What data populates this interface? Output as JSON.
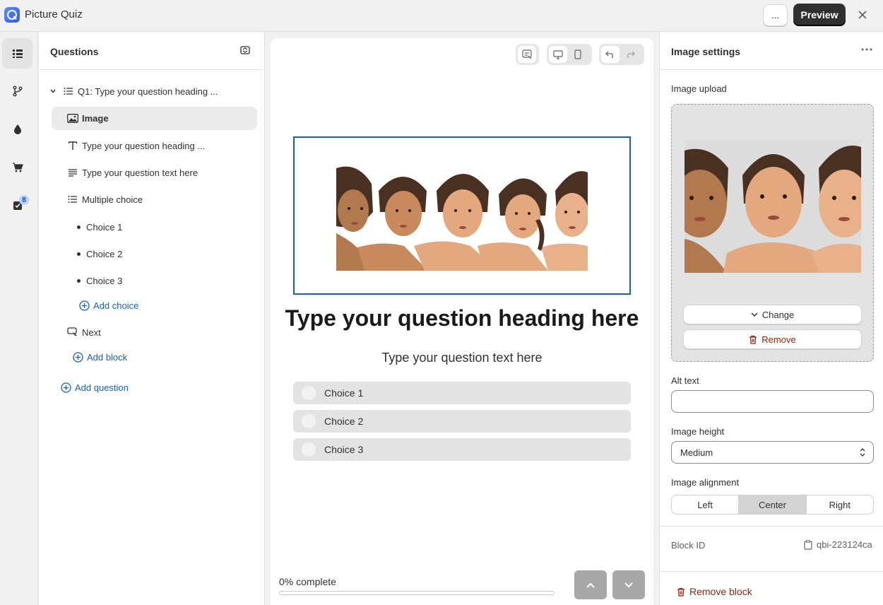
{
  "app": {
    "title": "Picture Quiz"
  },
  "topbar": {
    "more_label": "...",
    "preview_label": "Preview"
  },
  "rail": {
    "badge_count": "8"
  },
  "questions_panel": {
    "title": "Questions",
    "question": "Q1: Type your question heading ...",
    "blocks": {
      "image": "Image",
      "heading": "Type your question heading ...",
      "text": "Type your question text here",
      "multiple_choice": "Multiple choice",
      "choices": [
        "Choice 1",
        "Choice 2",
        "Choice 3"
      ],
      "add_choice": "Add choice",
      "next": "Next",
      "add_block": "Add block"
    },
    "add_question": "Add question"
  },
  "preview": {
    "heading": "Type your question heading here",
    "text": "Type your question text here",
    "choices": [
      "Choice 1",
      "Choice 2",
      "Choice 3"
    ],
    "progress_label": "0% complete",
    "progress_fraction": 0,
    "accent_color": "#1a5fb4"
  },
  "settings": {
    "title": "Image settings",
    "image_upload_label": "Image upload",
    "change_label": "Change",
    "remove_label": "Remove",
    "alt_text_label": "Alt text",
    "alt_text_value": "",
    "image_height_label": "Image height",
    "image_height_value": "Medium",
    "image_alignment_label": "Image alignment",
    "alignment_options": [
      "Left",
      "Center",
      "Right"
    ],
    "alignment_selected": "Center",
    "block_id_label": "Block ID",
    "block_id_value": "qbi-223124ca",
    "remove_block_label": "Remove block"
  }
}
